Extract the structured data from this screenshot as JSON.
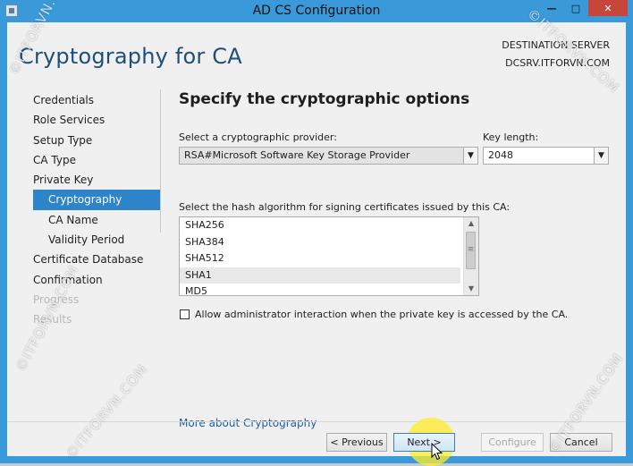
{
  "window": {
    "title": "AD CS Configuration"
  },
  "title_buttons": {
    "minimize": "—",
    "maximize": "□",
    "close": "✕"
  },
  "page_title": "Cryptography for CA",
  "destination": {
    "label": "DESTINATION SERVER",
    "server": "DCSRV.ITFORVN.COM"
  },
  "nav": {
    "items": [
      {
        "label": "Credentials"
      },
      {
        "label": "Role Services"
      },
      {
        "label": "Setup Type"
      },
      {
        "label": "CA Type"
      },
      {
        "label": "Private Key"
      },
      {
        "label": "Cryptography"
      },
      {
        "label": "CA Name"
      },
      {
        "label": "Validity Period"
      },
      {
        "label": "Certificate Database"
      },
      {
        "label": "Confirmation"
      },
      {
        "label": "Progress"
      },
      {
        "label": "Results"
      }
    ]
  },
  "main": {
    "heading": "Specify the cryptographic options",
    "provider_label": "Select a cryptographic provider:",
    "provider_value": "RSA#Microsoft Software Key Storage Provider",
    "key_length_label": "Key length:",
    "key_length_value": "2048",
    "hash_label": "Select the hash algorithm for signing certificates issued by this CA:",
    "hash_options": [
      "SHA256",
      "SHA384",
      "SHA512",
      "SHA1",
      "MD5"
    ],
    "hash_selected": "SHA1",
    "checkbox_label": "Allow administrator interaction when the private key is accessed by the CA.",
    "checkbox_checked": false,
    "more_link": "More about Cryptography"
  },
  "buttons": {
    "previous": "< Previous",
    "next": "Next >",
    "configure": "Configure",
    "cancel": "Cancel"
  },
  "watermark": "©ITFORVN.COM",
  "colors": {
    "accent": "#2d84c8",
    "title_bar": "#3a9ad9",
    "close_button": "#c7463b",
    "page_title": "#1e4e79",
    "link": "#1e5b9e",
    "cursor_highlight": "#ffee28"
  }
}
